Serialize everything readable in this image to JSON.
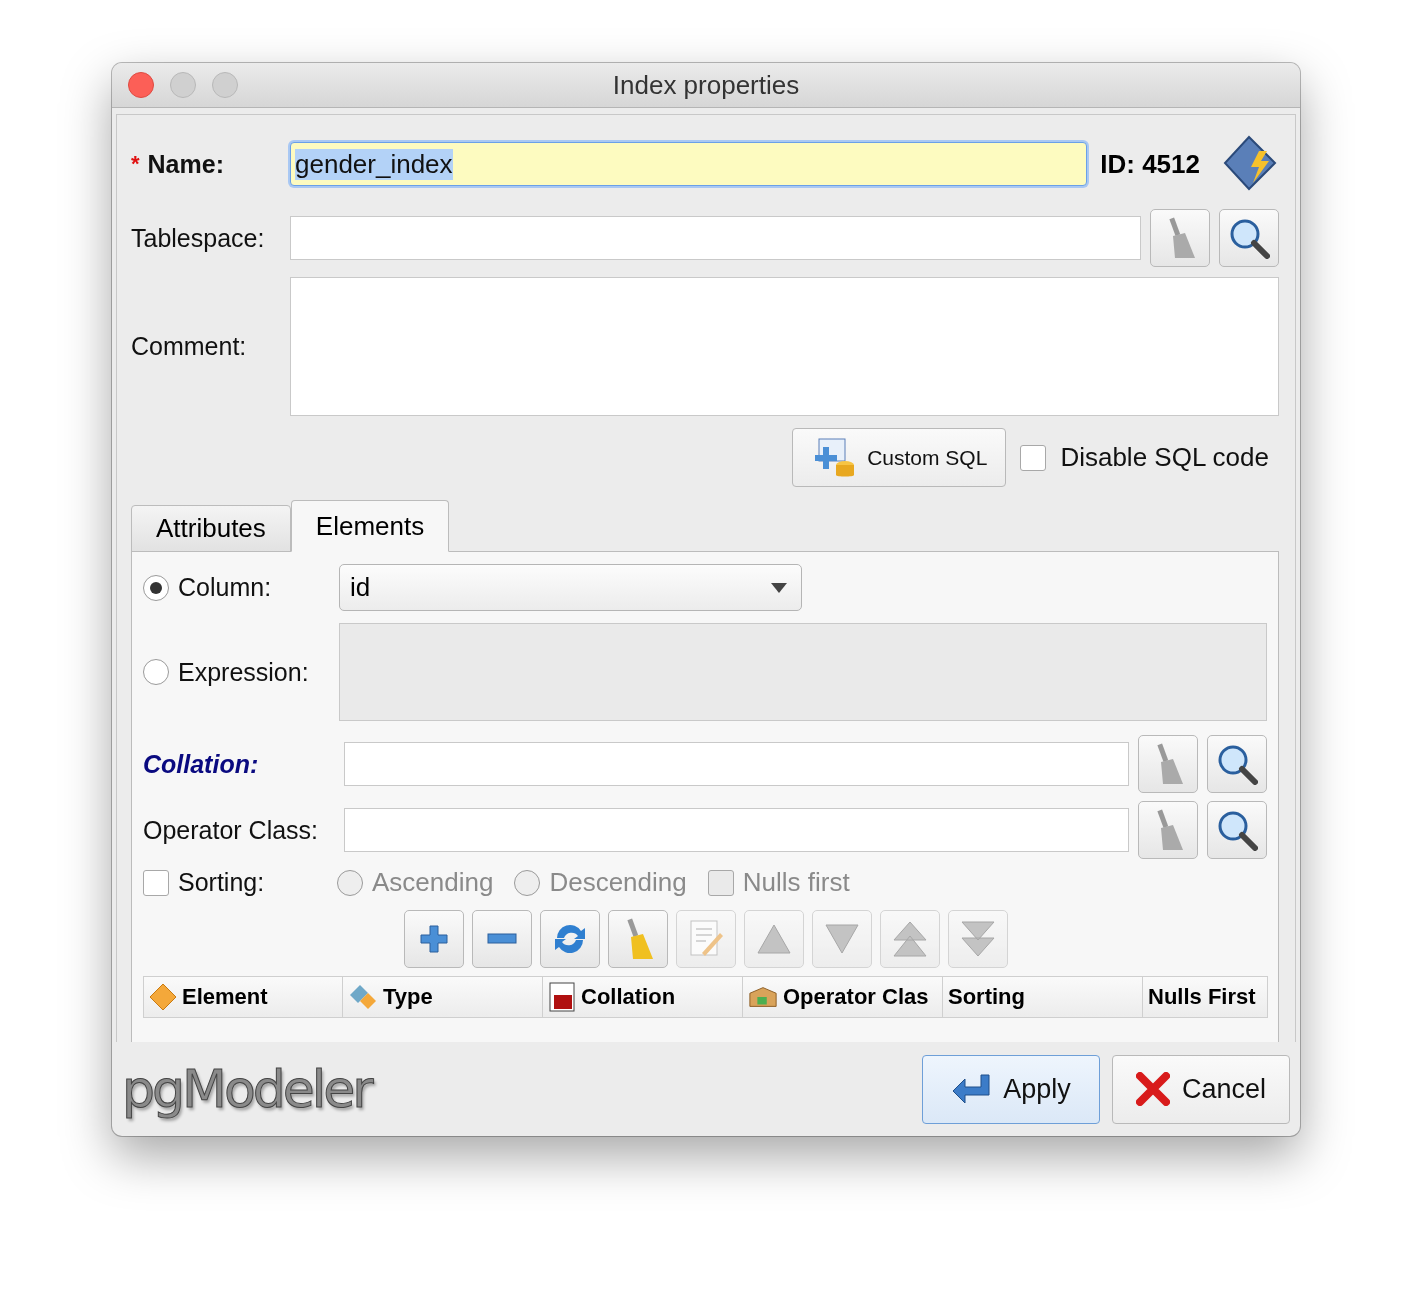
{
  "window": {
    "title": "Index properties"
  },
  "name": {
    "required_mark": "*",
    "label": "Name:",
    "value": "gender_index",
    "value_selected": true
  },
  "id_label": "ID: 4512",
  "tablespace": {
    "label": "Tablespace:"
  },
  "comment": {
    "label": "Comment:"
  },
  "custom_sql_button": "Custom SQL",
  "disable_sql": {
    "label": "Disable SQL code",
    "checked": false
  },
  "tabs": [
    {
      "label": "Attributes",
      "selected": false
    },
    {
      "label": "Elements",
      "selected": true
    }
  ],
  "elements": {
    "column": {
      "label": "Column:",
      "selected": true,
      "value": "id"
    },
    "expression": {
      "label": "Expression:",
      "selected": false
    },
    "collation": {
      "label": "Collation:",
      "highlighted": true
    },
    "operator_class": {
      "label": "Operator Class:",
      "highlighted": false
    },
    "sorting": {
      "label": "Sorting:",
      "checked": false
    },
    "sort_options": [
      {
        "kind": "radio",
        "label": "Ascending",
        "checked": false,
        "disabled": true
      },
      {
        "kind": "radio",
        "label": "Descending",
        "checked": false,
        "disabled": true
      },
      {
        "kind": "checkbox",
        "label": "Nulls first",
        "checked": false,
        "disabled": true
      }
    ],
    "toolbar": [
      {
        "kind": "add",
        "disabled": false
      },
      {
        "kind": "remove",
        "disabled": false
      },
      {
        "kind": "refresh",
        "disabled": false
      },
      {
        "kind": "clear",
        "disabled": false
      },
      {
        "kind": "edit",
        "disabled": true
      },
      {
        "kind": "up",
        "disabled": true
      },
      {
        "kind": "down",
        "disabled": true
      },
      {
        "kind": "top",
        "disabled": true
      },
      {
        "kind": "bottom",
        "disabled": true
      }
    ],
    "table": {
      "columns": [
        {
          "label": "Element",
          "kind": "element"
        },
        {
          "label": "Type",
          "kind": "type"
        },
        {
          "label": "Collation",
          "kind": "collation"
        },
        {
          "label": "Operator Clas",
          "kind": "opclass"
        },
        {
          "label": "Sorting",
          "kind": "plain"
        },
        {
          "label": "Nulls First",
          "kind": "plain"
        }
      ]
    }
  },
  "logo": "pgModeler",
  "buttons": [
    {
      "kind": "apply",
      "label": "Apply"
    },
    {
      "kind": "cancel",
      "label": "Cancel"
    }
  ]
}
